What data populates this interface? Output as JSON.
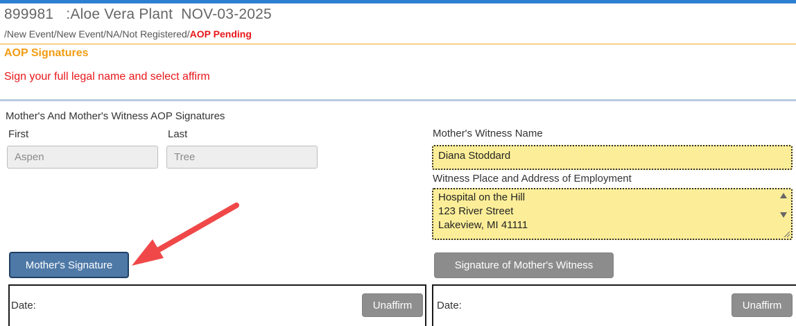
{
  "header": {
    "record_id": "899981",
    "record_name": ":Aloe Vera Plant",
    "record_date": "NOV-03-2025"
  },
  "breadcrumb": {
    "path": "/New Event/New Event/NA/Not Registered/",
    "status": "AOP Pending"
  },
  "colors": {
    "accent_blue": "#2f7fd0",
    "section_orange": "#f39c12",
    "status_red": "#e8161a",
    "field_yellow": "#fcee98",
    "primary_button": "#4e79a7",
    "disabled_button": "#8c8c8c",
    "annotation_arrow": "#f04848"
  },
  "section": {
    "title": "AOP Signatures",
    "instruction": "Sign your full legal name and select affirm"
  },
  "mother_panel": {
    "title": "Mother's And Mother's Witness AOP Signatures",
    "first_label": "First",
    "first_value": "Aspen",
    "last_label": "Last",
    "last_value": "Tree",
    "signature_button": "Mother's Signature",
    "date_label": "Date:",
    "unaffirm_button": "Unaffirm"
  },
  "witness_panel": {
    "name_label": "Mother's Witness Name",
    "name_value": "Diana Stoddard",
    "employment_label": "Witness Place and Address of Employment",
    "employment_lines": [
      "Hospital on the Hill",
      "123 River Street",
      "Lakeview, MI 41111"
    ],
    "signature_button": "Signature of Mother's Witness",
    "date_label": "Date:",
    "unaffirm_button": "Unaffirm"
  },
  "annotation": {
    "icon": "red-arrow-pointing-to-mothers-signature"
  }
}
